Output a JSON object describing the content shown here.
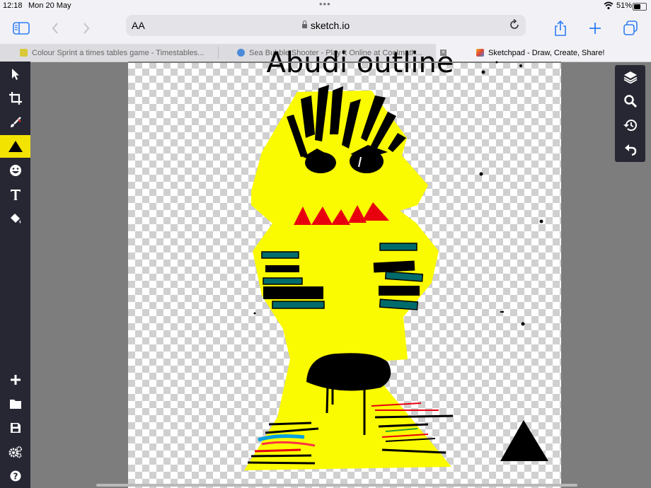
{
  "status_bar": {
    "time": "12:18",
    "date": "Mon 20 May",
    "battery": "51%"
  },
  "browser": {
    "text_size": "AA",
    "url": "sketch.io",
    "accent_color": "#2f7cf6",
    "tabs": [
      {
        "title": "Colour Sprint a times tables game - Timestables...",
        "active": false
      },
      {
        "title": "Sea Bubble Shooter - Play it Online at Coolmath...",
        "active": false
      },
      {
        "title": "Sketchpad - Draw, Create, Share!",
        "active": true
      }
    ]
  },
  "app": {
    "active_tool": "shape-tool",
    "active_tool_color": "#f3e300",
    "canvas_text": "Abudi outline",
    "tools": [
      "select",
      "crop",
      "brush",
      "shape",
      "sticker",
      "text",
      "fill"
    ],
    "bottom_tools": [
      "new",
      "open",
      "save",
      "settings",
      "help"
    ],
    "right_tools": [
      "layers",
      "zoom",
      "history",
      "undo"
    ]
  }
}
